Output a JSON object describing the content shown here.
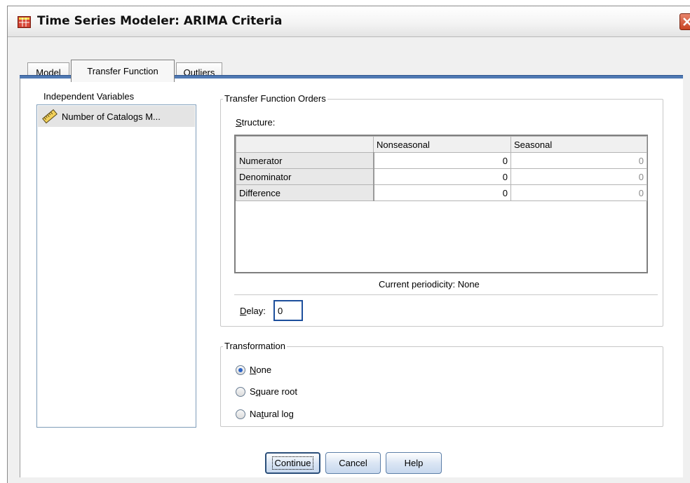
{
  "window": {
    "title": "Time Series Modeler: ARIMA Criteria"
  },
  "tabs": [
    {
      "label": "Model",
      "active": false
    },
    {
      "label": "Transfer Function",
      "active": true
    },
    {
      "label": "Outliers",
      "active": false
    }
  ],
  "variables": {
    "label": "Independent Variables",
    "items": [
      {
        "label": "Number of Catalogs M...",
        "icon": "scale-ruler-icon"
      }
    ]
  },
  "transfer_function": {
    "group_title": "Transfer Function Orders",
    "structure_label": "Structure:",
    "columns": [
      "",
      "Nonseasonal",
      "Seasonal"
    ],
    "rows": [
      {
        "label": "Numerator",
        "nonseasonal": "0",
        "seasonal": "0"
      },
      {
        "label": "Denominator",
        "nonseasonal": "0",
        "seasonal": "0"
      },
      {
        "label": "Difference",
        "nonseasonal": "0",
        "seasonal": "0"
      }
    ],
    "periodicity": "Current periodicity: None",
    "delay_label": "Delay:",
    "delay_value": "0"
  },
  "transformation": {
    "group_title": "Transformation",
    "options": [
      {
        "label": "None",
        "checked": true
      },
      {
        "label": "Square root",
        "checked": false
      },
      {
        "label": "Natural log",
        "checked": false
      }
    ]
  },
  "buttons": {
    "continue": "Continue",
    "cancel": "Cancel",
    "help": "Help"
  },
  "colors": {
    "tab_underline": "#4f79b3",
    "radio_selected": "#2b63c7",
    "close_button": "#c84422"
  }
}
